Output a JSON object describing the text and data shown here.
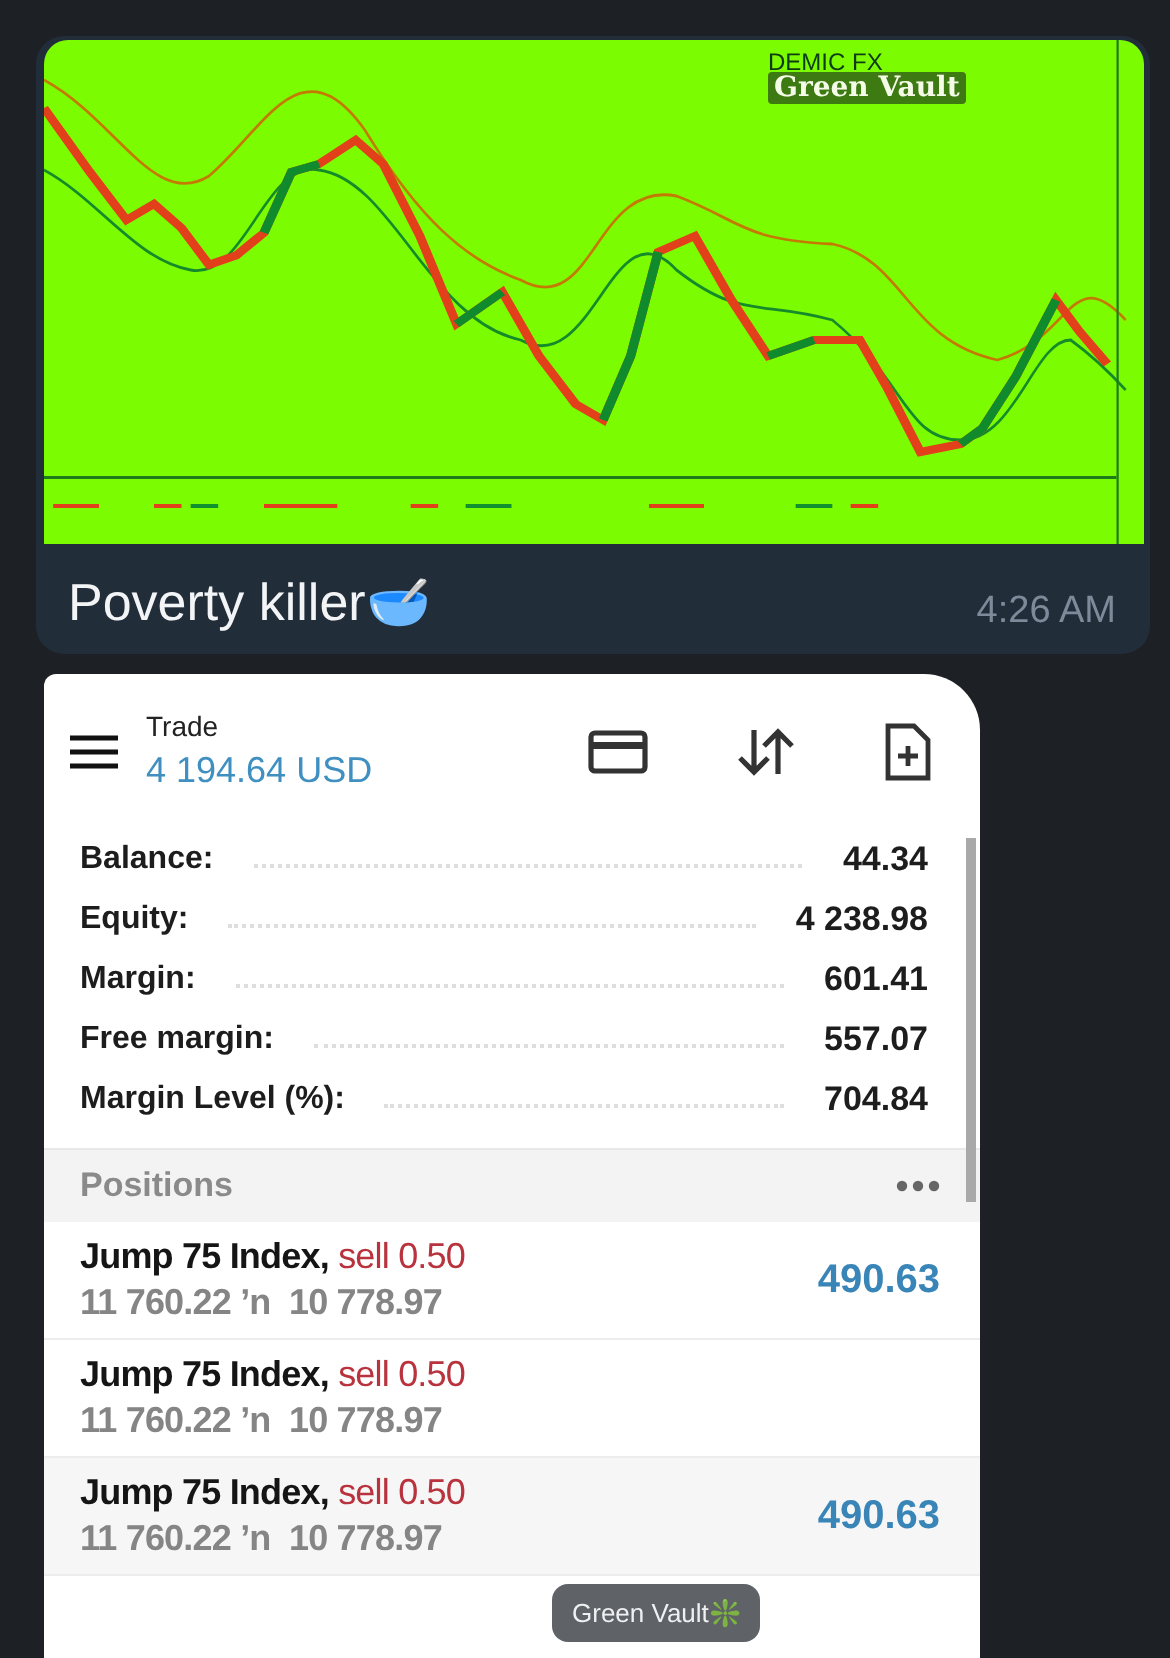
{
  "message": {
    "chart_image": {
      "title": "DEMIC FX",
      "subtitle": "Green Vault"
    },
    "caption": "Poverty killer🥣",
    "time": "4:26 AM"
  },
  "trade": {
    "header": {
      "title": "Trade",
      "balance": "4 194.64 USD"
    },
    "summary": [
      {
        "label": "Balance:",
        "value": "44.34"
      },
      {
        "label": "Equity:",
        "value": "4 238.98"
      },
      {
        "label": "Margin:",
        "value": "601.41"
      },
      {
        "label": "Free margin:",
        "value": "557.07"
      },
      {
        "label": "Margin Level (%):",
        "value": "704.84"
      }
    ],
    "positions": {
      "title": "Positions",
      "items": [
        {
          "symbol": "Jump 75 Index,",
          "side": "sell 0.50",
          "prices": "11 760.22 ʼn  10 778.97",
          "profit": "490.63"
        },
        {
          "symbol": "Jump 75 Index,",
          "side": "sell 0.50",
          "prices": "11 760.22 ʼn  10 778.97"
        },
        {
          "symbol": "Jump 75 Index,",
          "side": "sell 0.50",
          "prices": "11 760.22 ʼn  10 778.97",
          "profit": "490.63"
        }
      ]
    }
  },
  "signature": "Green Vault❇️"
}
